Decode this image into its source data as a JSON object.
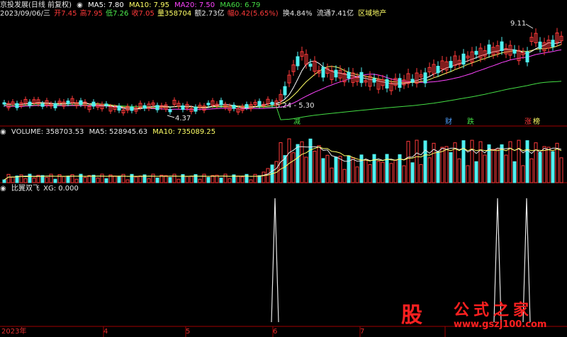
{
  "colors": {
    "background": "#000000",
    "up": "#ff3a3a",
    "down": "#4ff0f0",
    "ma5": "#ffffff",
    "ma10": "#ffff66",
    "ma20": "#ff44ff",
    "ma60": "#44dd44",
    "divider": "#a00000",
    "axis_text": "#e03030"
  },
  "price_panel": {
    "title": "京投发展(日线 前复权)",
    "ma5_label": "MA5: 7.80",
    "ma10_label": "MA10: 7.95",
    "ma20_label": "MA20: 7.50",
    "ma60_label": "MA60: 6.79",
    "quote_date": "2023/09/06/三",
    "open": "开7.45",
    "high": "高7.95",
    "low": "低7.26",
    "close": "收7.05",
    "volume": "量358704",
    "amount": "额2.73亿",
    "change": "幅0.42(5.65%)",
    "turnover": "换4.84%",
    "float": "流通7.41亿",
    "sector": "区域地产",
    "annotation_high": "9.11",
    "annotation_low": "4.37",
    "annotation_range": "5.24 - 5.30",
    "event_tags": [
      "减",
      "财",
      "跌",
      "涨",
      "榜"
    ]
  },
  "volume_panel": {
    "volume_label": "VOLUME: 358703.53",
    "ma5_label": "MA5: 528945.63",
    "ma10_label": "MA10: 735089.25"
  },
  "indicator_panel": {
    "name_label": "比翼双飞",
    "value_label": "XG: 0.000"
  },
  "time_axis": {
    "labels": [
      "2023年",
      "4",
      "5",
      "6",
      "7"
    ]
  },
  "watermark": {
    "logo_char": "股",
    "site_name": "公式之家",
    "url": "www.gszj100.com"
  },
  "chart_data": {
    "type": "candlestick",
    "series": [
      {
        "name": "MA5"
      },
      {
        "name": "MA10"
      },
      {
        "name": "MA20"
      },
      {
        "name": "MA60"
      }
    ],
    "volume_series": "VOLUME",
    "indicator_series": "XG",
    "indicator_spikes": [
      1,
      1,
      1
    ]
  }
}
